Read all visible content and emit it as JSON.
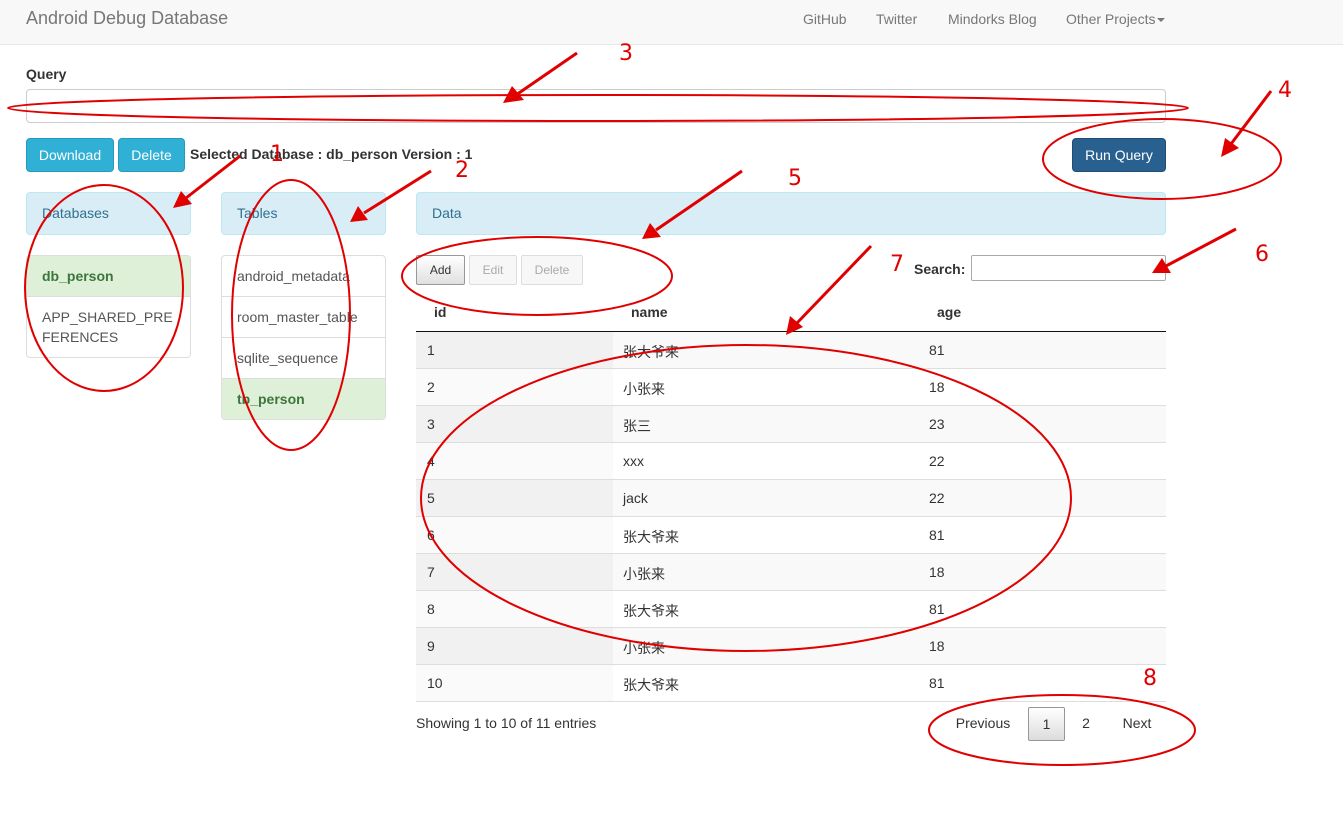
{
  "navbar": {
    "brand": "Android Debug Database",
    "links": [
      "GitHub",
      "Twitter",
      "Mindorks Blog",
      "Other Projects"
    ]
  },
  "query": {
    "label": "Query",
    "value": "",
    "run_label": "Run Query"
  },
  "toolbar": {
    "download_label": "Download",
    "delete_label": "Delete",
    "selected_db_text": "Selected Database : db_person Version : 1"
  },
  "databases": {
    "header": "Databases",
    "items": [
      "db_person",
      "APP_SHARED_PRE\nFERENCES"
    ],
    "active_index": 0
  },
  "tables": {
    "header": "Tables",
    "items": [
      "android_metadata",
      "room_master_table",
      "sqlite_sequence",
      "tb_person"
    ],
    "active_index": 3
  },
  "data": {
    "header": "Data",
    "add_label": "Add",
    "edit_label": "Edit",
    "delete_label": "Delete",
    "search_label": "Search:",
    "search_value": "",
    "columns": [
      "id",
      "name",
      "age"
    ],
    "rows": [
      [
        "1",
        "张大爷来",
        "81"
      ],
      [
        "2",
        "小张来",
        "18"
      ],
      [
        "3",
        "张三",
        "23"
      ],
      [
        "4",
        "xxx",
        "22"
      ],
      [
        "5",
        "jack",
        "22"
      ],
      [
        "6",
        "张大爷来",
        "81"
      ],
      [
        "7",
        "小张来",
        "18"
      ],
      [
        "8",
        "张大爷来",
        "81"
      ],
      [
        "9",
        "小张来",
        "18"
      ],
      [
        "10",
        "张大爷来",
        "81"
      ]
    ],
    "info": "Showing 1 to 10 of 11 entries",
    "pagination": {
      "previous": "Previous",
      "pages": [
        "1",
        "2"
      ],
      "current": "1",
      "next": "Next"
    }
  },
  "annotations": {
    "color": "#e00000",
    "numbers": [
      "1",
      "2",
      "3",
      "4",
      "5",
      "6",
      "7",
      "8"
    ]
  },
  "colors": {
    "info_button": "#31b0d5",
    "primary_button": "#286090",
    "panel_heading": "#d9edf7",
    "active_item": "#dff0d8"
  }
}
